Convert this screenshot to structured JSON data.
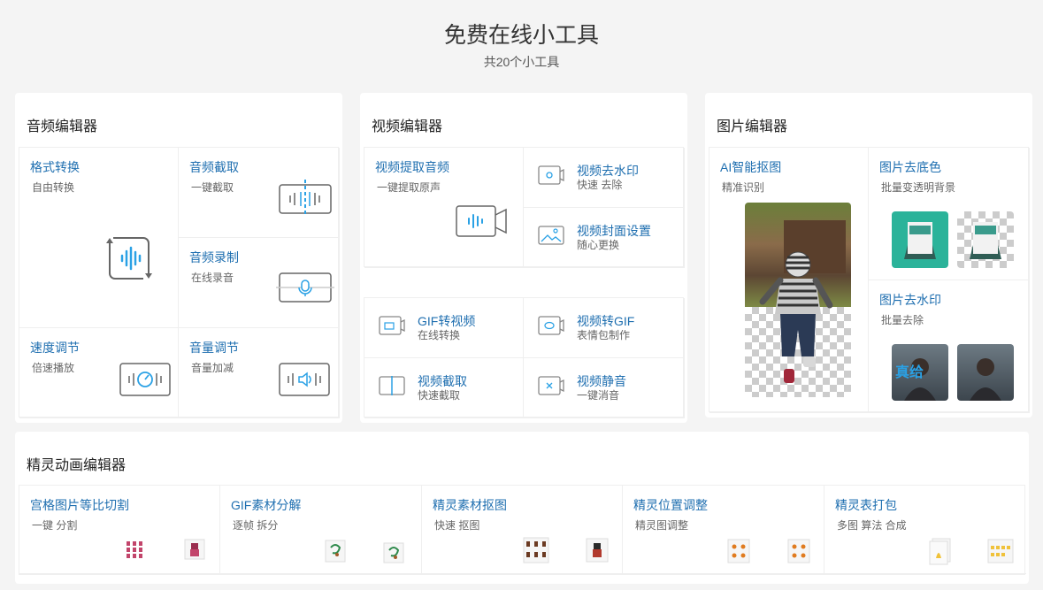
{
  "header": {
    "title": "免费在线小工具",
    "subtitle": "共20个小工具"
  },
  "audio": {
    "title": "音频编辑器",
    "tools": [
      {
        "name": "格式转换",
        "desc": "自由转换"
      },
      {
        "name": "音频截取",
        "desc": "一键截取"
      },
      {
        "name": "音频录制",
        "desc": "在线录音"
      },
      {
        "name": "速度调节",
        "desc": "倍速播放"
      },
      {
        "name": "音量调节",
        "desc": "音量加减"
      }
    ]
  },
  "video": {
    "title": "视频编辑器",
    "tools": [
      {
        "name": "视频提取音频",
        "desc": "一键提取原声"
      },
      {
        "name": "视频去水印",
        "desc": "快速 去除"
      },
      {
        "name": "视频封面设置",
        "desc": "随心更换"
      },
      {
        "name": "GIF转视频",
        "desc": "在线转换"
      },
      {
        "name": "视频转GIF",
        "desc": "表情包制作"
      },
      {
        "name": "视频截取",
        "desc": "快速截取"
      },
      {
        "name": "视频静音",
        "desc": "一键消音"
      }
    ]
  },
  "image": {
    "title": "图片编辑器",
    "tools": [
      {
        "name": "AI智能抠图",
        "desc": "精准识别"
      },
      {
        "name": "图片去底色",
        "desc": "批量变透明背景"
      },
      {
        "name": "图片去水印",
        "desc": "批量去除"
      }
    ],
    "watermark_text": "真给"
  },
  "sprite": {
    "title": "精灵动画编辑器",
    "tools": [
      {
        "name": "宫格图片等比切割",
        "desc": "一键 分割"
      },
      {
        "name": "GIF素材分解",
        "desc": "逐帧 拆分"
      },
      {
        "name": "精灵素材抠图",
        "desc": "快速 抠图"
      },
      {
        "name": "精灵位置调整",
        "desc": "精灵图调整"
      },
      {
        "name": "精灵表打包",
        "desc": "多图 算法 合成"
      }
    ]
  },
  "colors": {
    "link": "#1f6fb0",
    "accent": "#2aa1e5",
    "teal": "#2bb39a"
  }
}
